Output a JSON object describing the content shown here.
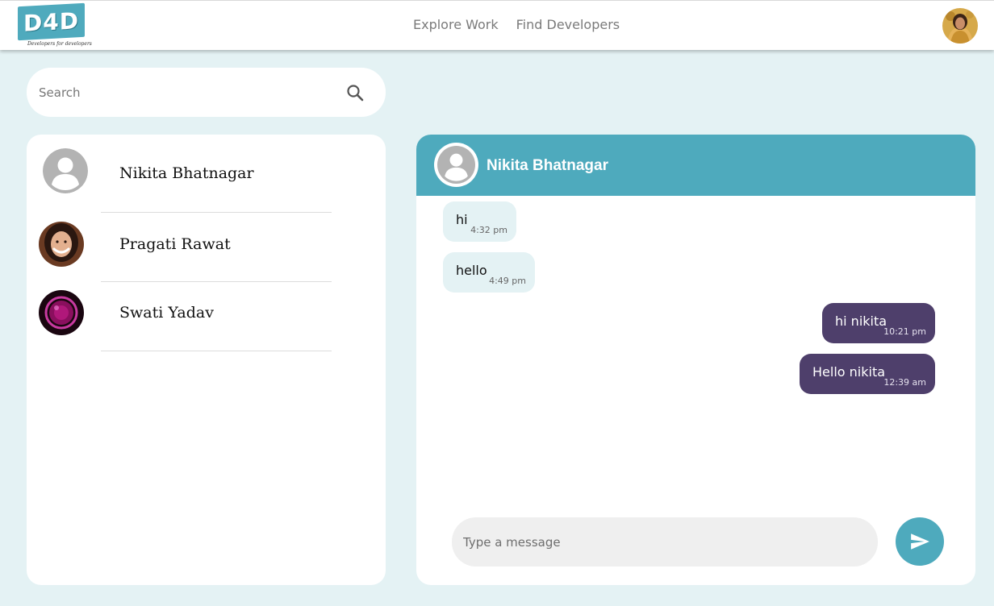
{
  "brand": {
    "logo_text": "D4D",
    "tagline": "Developers for developers",
    "accent_color": "#4eaabd"
  },
  "nav": {
    "links": [
      {
        "label": "Explore Work"
      },
      {
        "label": "Find Developers"
      }
    ]
  },
  "search": {
    "placeholder": "Search",
    "icon": "search-icon"
  },
  "contacts": [
    {
      "name": "Nikita Bhatnagar",
      "avatar": "default-user-icon"
    },
    {
      "name": "Pragati Rawat",
      "avatar": "photo"
    },
    {
      "name": "Swati Yadav",
      "avatar": "photo"
    }
  ],
  "chat": {
    "contact_name": "Nikita Bhatnagar",
    "messages": [
      {
        "text": "hi",
        "time": "4:32 pm",
        "direction": "incoming"
      },
      {
        "text": "hello",
        "time": "4:49 pm",
        "direction": "incoming"
      },
      {
        "text": "hi nikita",
        "time": "10:21 pm",
        "direction": "outgoing"
      },
      {
        "text": "Hello nikita",
        "time": "12:39 am",
        "direction": "outgoing"
      }
    ],
    "input_placeholder": "Type a message",
    "send_icon": "send-icon",
    "incoming_color": "#e4f2f4",
    "outgoing_color": "#4e3f6b"
  }
}
